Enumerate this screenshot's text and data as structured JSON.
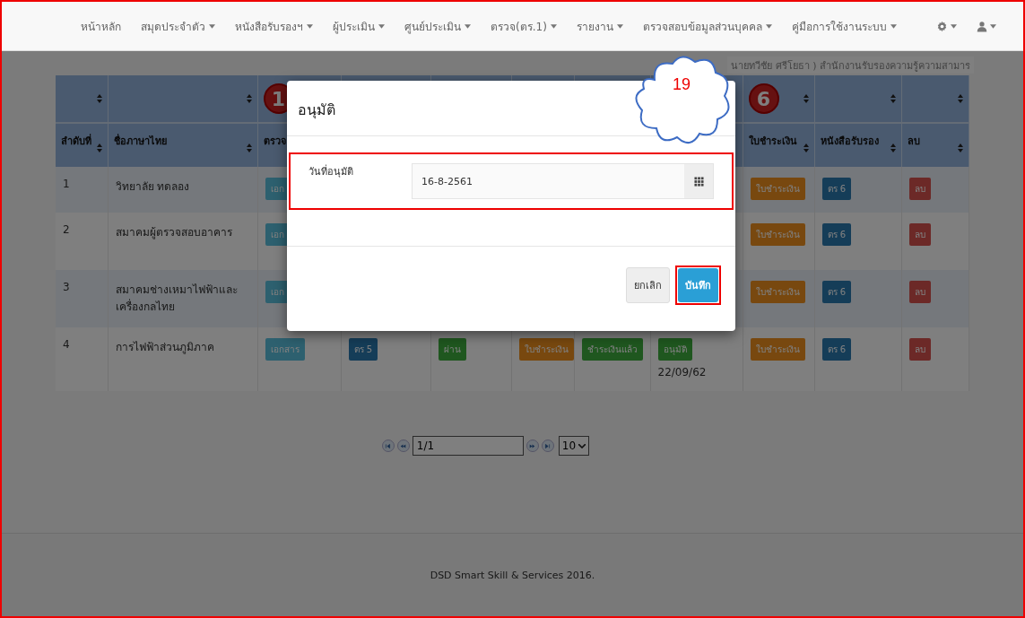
{
  "navbar": {
    "items": [
      {
        "label": "หน้าหลัก",
        "has_menu": false
      },
      {
        "label": "สมุดประจำตัว",
        "has_menu": true
      },
      {
        "label": "หนังสือรับรองฯ",
        "has_menu": true
      },
      {
        "label": "ผู้ประเมิน",
        "has_menu": true
      },
      {
        "label": "ศูนย์ประเมิน",
        "has_menu": true
      },
      {
        "label": "ตรวจ(ตร.1)",
        "has_menu": true
      },
      {
        "label": "รายงาน",
        "has_menu": true
      },
      {
        "label": "ตรวจสอบข้อมูลส่วนบุคคล",
        "has_menu": true
      },
      {
        "label": "คู่มือการใช้งานระบบ",
        "has_menu": true
      }
    ],
    "icons": [
      {
        "kind": "gear",
        "has_menu": true
      },
      {
        "kind": "user",
        "has_menu": true
      }
    ]
  },
  "user_line": "นายทวีชัย ศรีโยธา ) สำนักงานรับรองความรู้ความสามาร",
  "table": {
    "columns": [
      {
        "label": "ลำดับที่",
        "sortable": true
      },
      {
        "label": "ชื่อภาษาไทย",
        "sortable": true
      },
      {
        "label": "ตรวจ",
        "badge": "1"
      },
      {},
      {},
      {},
      {},
      {},
      {
        "label": "ใบชำระเงิน",
        "badge": "6",
        "sortable": true
      },
      {
        "label": "หนังสือรับรอง",
        "sortable": true
      },
      {
        "label": "ลบ",
        "sortable": true
      }
    ],
    "rows": [
      {
        "cells": [
          {
            "text": "1"
          },
          {
            "text": "วิทยาลัย ทดลอง"
          },
          {
            "buttons": [
              {
                "kind": "info",
                "text": "เอก"
              }
            ]
          },
          null,
          null,
          null,
          null,
          null,
          {
            "buttons": [
              {
                "kind": "warning",
                "text": "ใบชำระเงิน"
              }
            ]
          },
          {
            "buttons": [
              {
                "kind": "primary",
                "text": "ตร 6"
              }
            ]
          },
          {
            "buttons": [
              {
                "kind": "danger",
                "text": "ลบ"
              }
            ]
          }
        ]
      },
      {
        "cells": [
          {
            "text": "2"
          },
          {
            "text": "สมาคมผู้ตรวจสอบอาคาร"
          },
          {
            "buttons": [
              {
                "kind": "info",
                "text": "เอก"
              }
            ]
          },
          null,
          null,
          null,
          null,
          null,
          {
            "buttons": [
              {
                "kind": "warning",
                "text": "ใบชำระเงิน"
              }
            ]
          },
          {
            "buttons": [
              {
                "kind": "primary",
                "text": "ตร 6"
              }
            ]
          },
          {
            "buttons": [
              {
                "kind": "danger",
                "text": "ลบ"
              }
            ]
          }
        ]
      },
      {
        "cells": [
          {
            "text": "3"
          },
          {
            "text": "สมาคมช่างเหมาไฟฟ้าและเครื่องกลไทย"
          },
          {
            "buttons": [
              {
                "kind": "info",
                "text": "เอก"
              }
            ]
          },
          null,
          null,
          null,
          null,
          null,
          {
            "buttons": [
              {
                "kind": "warning",
                "text": "ใบชำระเงิน"
              }
            ]
          },
          {
            "buttons": [
              {
                "kind": "primary",
                "text": "ตร 6"
              }
            ]
          },
          {
            "buttons": [
              {
                "kind": "danger",
                "text": "ลบ"
              }
            ]
          }
        ]
      },
      {
        "cells": [
          {
            "text": "4"
          },
          {
            "text": "การไฟฟ้าส่วนภูมิภาค"
          },
          {
            "buttons": [
              {
                "kind": "info",
                "text": "เอกสาร"
              }
            ]
          },
          {
            "buttons": [
              {
                "kind": "primary",
                "text": "ตร 5"
              }
            ]
          },
          {
            "buttons": [
              {
                "kind": "success",
                "text": "ผ่าน"
              }
            ]
          },
          {
            "buttons": [
              {
                "kind": "warning",
                "text": "ใบชำระเงิน"
              }
            ]
          },
          {
            "buttons": [
              {
                "kind": "success",
                "text": "ชำระเงินแล้ว"
              }
            ]
          },
          {
            "buttons": [
              {
                "kind": "success",
                "text": "อนุมัติ"
              }
            ],
            "note": "22/09/62"
          },
          {
            "buttons": [
              {
                "kind": "warning",
                "text": "ใบชำระเงิน"
              }
            ]
          },
          {
            "buttons": [
              {
                "kind": "primary",
                "text": "ตร 6"
              }
            ]
          },
          {
            "buttons": [
              {
                "kind": "danger",
                "text": "ลบ"
              }
            ]
          }
        ]
      }
    ]
  },
  "pagination": {
    "page": "1/1",
    "page_size": "10"
  },
  "footer": "DSD Smart Skill & Services 2016.",
  "modal": {
    "title": "อนุมัติ",
    "field_label": "วันที่อนุมัติ",
    "field_value": "16-8-2561",
    "field_highlighted": true,
    "buttons": [
      {
        "label": "ยกเลิก",
        "kind": "default",
        "highlighted": false
      },
      {
        "label": "บันทึก",
        "kind": "primary",
        "highlighted": true
      }
    ]
  },
  "callout": "19"
}
